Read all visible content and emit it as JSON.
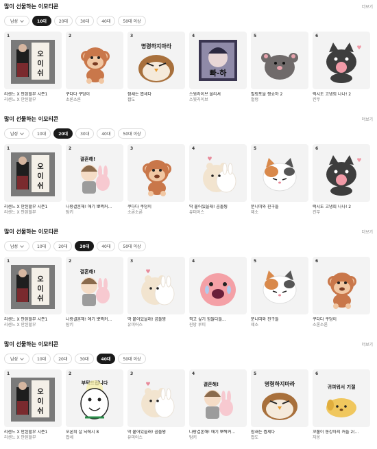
{
  "filter_labels": {
    "gender": "남성",
    "ages": [
      "10대",
      "20대",
      "30대",
      "40대",
      "50대 이상"
    ]
  },
  "sections": [
    {
      "title": "많이 선물하는 이모티콘",
      "more": "더보기",
      "active_age": 0,
      "items": [
        {
          "rank": "1",
          "name": "리센느 X 안된할부 시즌1",
          "author": "리센느 X 안된할부",
          "art": "photo-sign"
        },
        {
          "rank": "2",
          "name": "쿠다다 쿠덩이",
          "author": "소론소론",
          "art": "monkey"
        },
        {
          "rank": "3",
          "name": "참새는 짭세다",
          "author": "짭도",
          "art": "sparrow-order"
        },
        {
          "rank": "4",
          "name": "스윗라이브 올리셔",
          "author": "스윗라이브",
          "art": "anime-frame"
        },
        {
          "rank": "5",
          "name": "벌렁포을 짱쇼하 2",
          "author": "벌렁",
          "art": "grey-muscle"
        },
        {
          "rank": "6",
          "name": "럭시도 고냉희 나나! 2",
          "author": "킨무",
          "art": "black-cat"
        }
      ]
    },
    {
      "title": "많이 선물하는 이모티콘",
      "more": "더보기",
      "active_age": 1,
      "items": [
        {
          "rank": "1",
          "name": "리센느 X 안된할부 시즌1",
          "author": "리센느 X 안된할부",
          "art": "photo-sign"
        },
        {
          "rank": "2",
          "name": "나랑결혼해! 애기 뽀짝커...",
          "author": "탐키",
          "art": "boy-bunny"
        },
        {
          "rank": "3",
          "name": "쿠다다 쿠덩이",
          "author": "소론소론",
          "art": "monkey"
        },
        {
          "rank": "4",
          "name": "딱 붙어있을래! 곰돌찡",
          "author": "유미어스",
          "art": "bear-hug"
        },
        {
          "rank": "5",
          "name": "뚠니띠와 친구들",
          "author": "제소",
          "art": "calico-cat"
        },
        {
          "rank": "6",
          "name": "럭시도 고냉희 나나! 2",
          "author": "킨무",
          "art": "black-cat"
        }
      ]
    },
    {
      "title": "많이 선물하는 이모티콘",
      "more": "더보기",
      "active_age": 2,
      "items": [
        {
          "rank": "1",
          "name": "리센느 X 안된할부 시즌1",
          "author": "리센느 X 안된할부",
          "art": "photo-sign"
        },
        {
          "rank": "2",
          "name": "나랑결혼해! 애기 뽀짝커...",
          "author": "탐키",
          "art": "boy-bunny"
        },
        {
          "rank": "3",
          "name": "딱 붙어있을래! 곰돌찡",
          "author": "유미어스",
          "art": "bear-hug"
        },
        {
          "rank": "4",
          "name": "꺽고 싶기 힘들다들...",
          "author": "진망 루피",
          "art": "pink-blob"
        },
        {
          "rank": "5",
          "name": "뚠니띠와 친구들",
          "author": "제소",
          "art": "calico-cat"
        },
        {
          "rank": "6",
          "name": "쿠다다 쿠덩이",
          "author": "소론소론",
          "art": "monkey"
        }
      ]
    },
    {
      "title": "많이 선물하는 이모티콘",
      "more": "더보기",
      "active_age": 3,
      "items": [
        {
          "rank": "1",
          "name": "리센느 X 안된할부 시즌1",
          "author": "리센느 X 안된할부",
          "art": "photo-sign"
        },
        {
          "rank": "2",
          "name": "오론희 살 뇌에시 8",
          "author": "짭세",
          "art": "mask-man"
        },
        {
          "rank": "3",
          "name": "딱 붙어있을래! 곰돌찡",
          "author": "유미어스",
          "art": "bear-hug"
        },
        {
          "rank": "4",
          "name": "나랑결혼해! 애기 뽀짝커...",
          "author": "탐키",
          "art": "boy-bunny"
        },
        {
          "rank": "5",
          "name": "참새는 짭세다",
          "author": "짭도",
          "art": "sparrow-order"
        },
        {
          "rank": "6",
          "name": "꼬뿔이 동강아지 커플 2(...",
          "author": "자옹",
          "art": "yellow-dog"
        }
      ]
    }
  ],
  "art_text": {
    "sign": "오이쉬",
    "order": "명령하지마라",
    "anime": "빠-하",
    "marry": "결혼해!",
    "cheer": "부탁드립니다",
    "cute": "귀여워서 기절"
  }
}
